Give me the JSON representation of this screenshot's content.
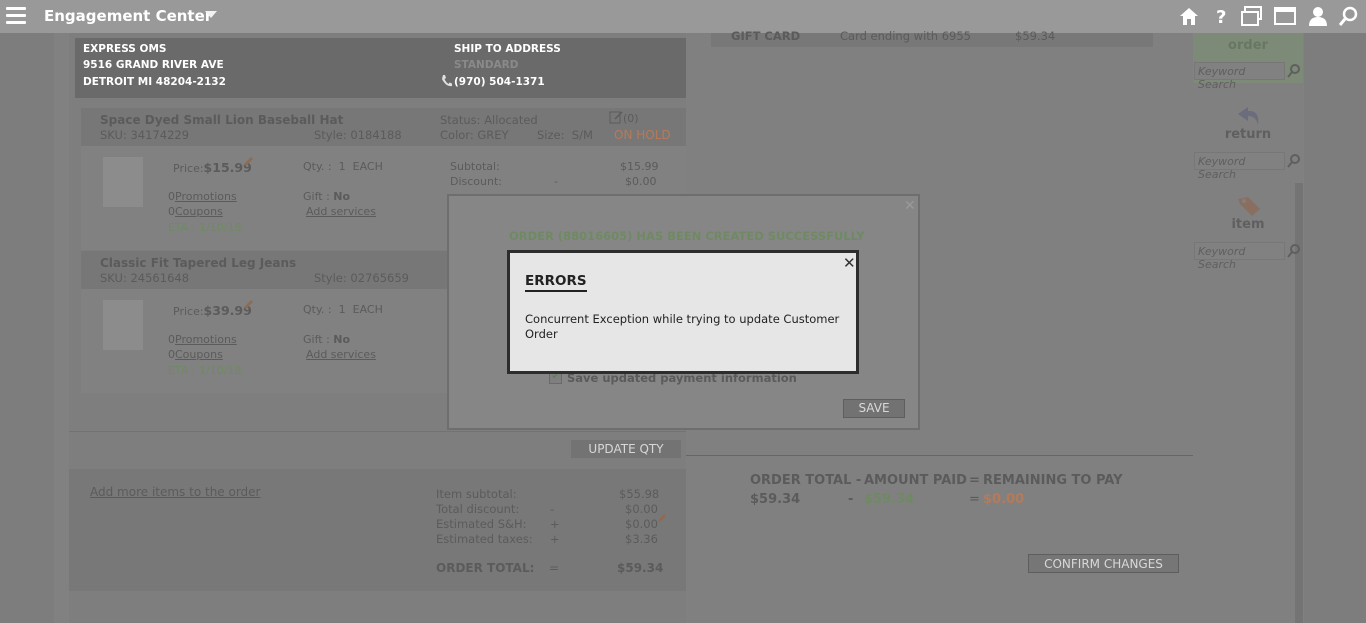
{
  "app": {
    "title": "Engagement Center"
  },
  "order": {
    "store": {
      "name": "EXPRESS OMS",
      "street": "9516 GRAND RIVER AVE",
      "city": "DETROIT MI 48204-2132"
    },
    "ship": {
      "label": "SHIP TO ADDRESS",
      "method": "STANDARD",
      "phone": "(970) 504-1371"
    },
    "items": [
      {
        "name": "Space Dyed Small Lion Baseball Hat",
        "sku_label": "SKU:",
        "sku": "34174229",
        "style_label": "Style:",
        "style": "0184188",
        "status_label": "Status:",
        "status": "Allocated",
        "color_label": "Color:",
        "color": "GREY",
        "size_label": "Size:",
        "size": "S/M",
        "notes": "(0)",
        "hold": "ON HOLD",
        "price_label": "Price:",
        "price": "$15.99",
        "qty_label": "Qty. :",
        "qty": "1",
        "qty_unit": "EACH",
        "promotions_count": "0",
        "promotions": "Promotions",
        "coupons_count": "0",
        "coupons": "Coupons",
        "gift_label": "Gift :",
        "gift": "No",
        "add_services": "Add services",
        "eta": "ETA : 1/10/18",
        "subtotal_label": "Subtotal:",
        "subtotal": "$15.99",
        "discount_label": "Discount:",
        "discount_sign": "-",
        "discount": "$0.00"
      },
      {
        "name": "Classic Fit Tapered Leg Jeans",
        "sku_label": "SKU:",
        "sku": "24561648",
        "style_label": "Style:",
        "style": "02765659",
        "price_label": "Price:",
        "price": "$39.99",
        "qty_label": "Qty. :",
        "qty": "1",
        "qty_unit": "EACH",
        "promotions_count": "0",
        "promotions": "Promotions",
        "coupons_count": "0",
        "coupons": "Coupons",
        "gift_label": "Gift :",
        "gift": "No",
        "add_services": "Add services",
        "eta": "ETA : 1/10/18"
      }
    ],
    "update_qty": "UPDATE QTY",
    "add_more": "Add more items to the order",
    "summary": {
      "item_subtotal_label": "Item subtotal:",
      "item_subtotal": "$55.98",
      "total_discount_label": "Total discount:",
      "total_discount_sign": "-",
      "total_discount": "$0.00",
      "sh_label": "Estimated S&H:",
      "sh_sign": "+",
      "sh": "$0.00",
      "taxes_label": "Estimated taxes:",
      "taxes_sign": "+",
      "taxes": "$3.36",
      "order_total_label": "ORDER TOTAL:",
      "order_total_sign": "=",
      "order_total": "$59.34"
    }
  },
  "payment": {
    "type": "GIFT CARD",
    "detail": "Card ending with 6955",
    "amount": "$59.34",
    "order_total_label": "ORDER TOTAL -",
    "amount_paid_label": "AMOUNT PAID",
    "eq": "=",
    "remaining_label": "REMAINING TO PAY",
    "order_total": "$59.34",
    "minus": "-",
    "amount_paid": "$59.34",
    "remaining": "$0.00",
    "confirm": "CONFIRM CHANGES"
  },
  "sidebar": {
    "order_label": "order",
    "return_label": "return",
    "item_label": "item",
    "keyword_placeholder": "Keyword Search"
  },
  "modal": {
    "success": "ORDER (88016605) HAS BEEN CREATED SUCCESSFULLY",
    "save_payment": "Save updated payment information",
    "save": "SAVE"
  },
  "error_dialog": {
    "title": "ERRORS",
    "message": "Concurrent Exception while trying to update Customer Order"
  }
}
